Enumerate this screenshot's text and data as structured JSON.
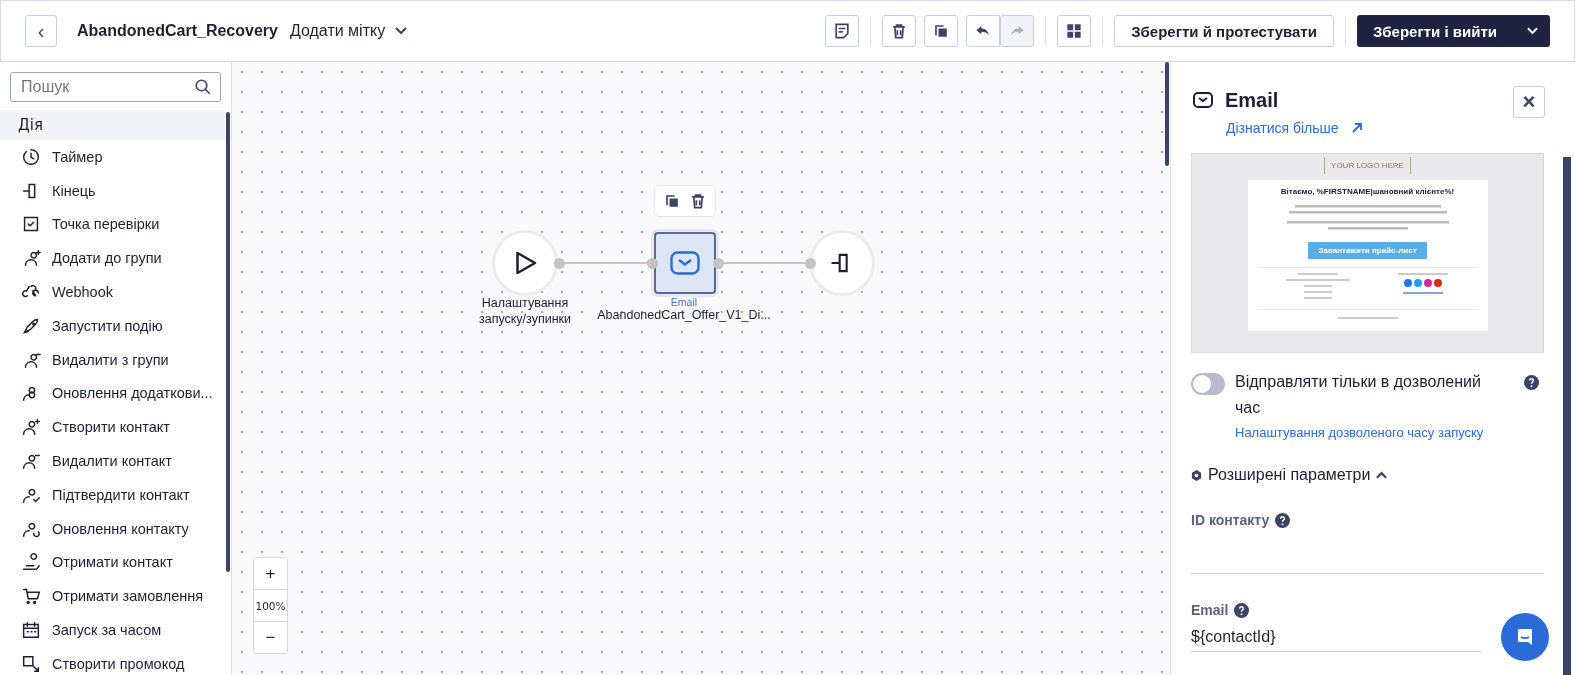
{
  "header": {
    "back": "‹",
    "title": "AbandonedCart_Recovery",
    "tag_label": "Додати мітку",
    "tools": [
      {
        "kind": "note",
        "disabled": false
      },
      {
        "kind": "delete",
        "disabled": false
      },
      {
        "kind": "copy",
        "disabled": false
      },
      {
        "kind": "undo",
        "disabled": false
      },
      {
        "kind": "redo",
        "disabled": true
      },
      {
        "kind": "layout",
        "disabled": false
      }
    ],
    "save_test": "Зберегти й протестувати",
    "save_exit": "Зберегти і вийти"
  },
  "sidebar": {
    "search_placeholder": "Пошук",
    "section": "Дія",
    "items": [
      {
        "label": "Таймер"
      },
      {
        "label": "Кінець"
      },
      {
        "label": "Точка перевірки"
      },
      {
        "label": "Додати до групи"
      },
      {
        "label": "Webhook"
      },
      {
        "label": "Запустити подію"
      },
      {
        "label": "Видалити з групи"
      },
      {
        "label": "Оновлення додаткови..."
      },
      {
        "label": "Створити контакт"
      },
      {
        "label": "Видалити контакт"
      },
      {
        "label": "Підтвердити контакт"
      },
      {
        "label": "Оновлення контакту"
      },
      {
        "label": "Отримати контакт"
      },
      {
        "label": "Отримати замовлення"
      },
      {
        "label": "Запуск за часом"
      },
      {
        "label": "Створити промокод"
      }
    ]
  },
  "canvas": {
    "nodes": [
      {
        "kind": "start",
        "label": "Налаштування запуску/зупинки",
        "selected": false
      },
      {
        "kind": "email",
        "type_label": "Email",
        "label": "AbandonedCart_Offer_V1_Di...",
        "selected": true
      },
      {
        "kind": "end",
        "selected": false
      }
    ],
    "zoom_in": "+",
    "zoom": "100%",
    "zoom_out": "−"
  },
  "panel": {
    "title": "Email",
    "learn_more": "Дізнатися більше",
    "close": "×",
    "preview": {
      "logo": "YOUR LOGO HERE",
      "heading": "Вітаємо, %FIRSTNAME|шановний клієнте%!",
      "button": "Завантажити прайс-лист"
    },
    "toggle": {
      "label": "Відправляти тільки в дозволений час",
      "on": false
    },
    "time_link": "Налаштування дозволеного часу запуску",
    "advanced": {
      "label": "Розширені параметри",
      "expanded": true
    },
    "fields": [
      {
        "label": "ID контакту"
      },
      {
        "label": "Email",
        "value": "${contactId}"
      }
    ]
  }
}
